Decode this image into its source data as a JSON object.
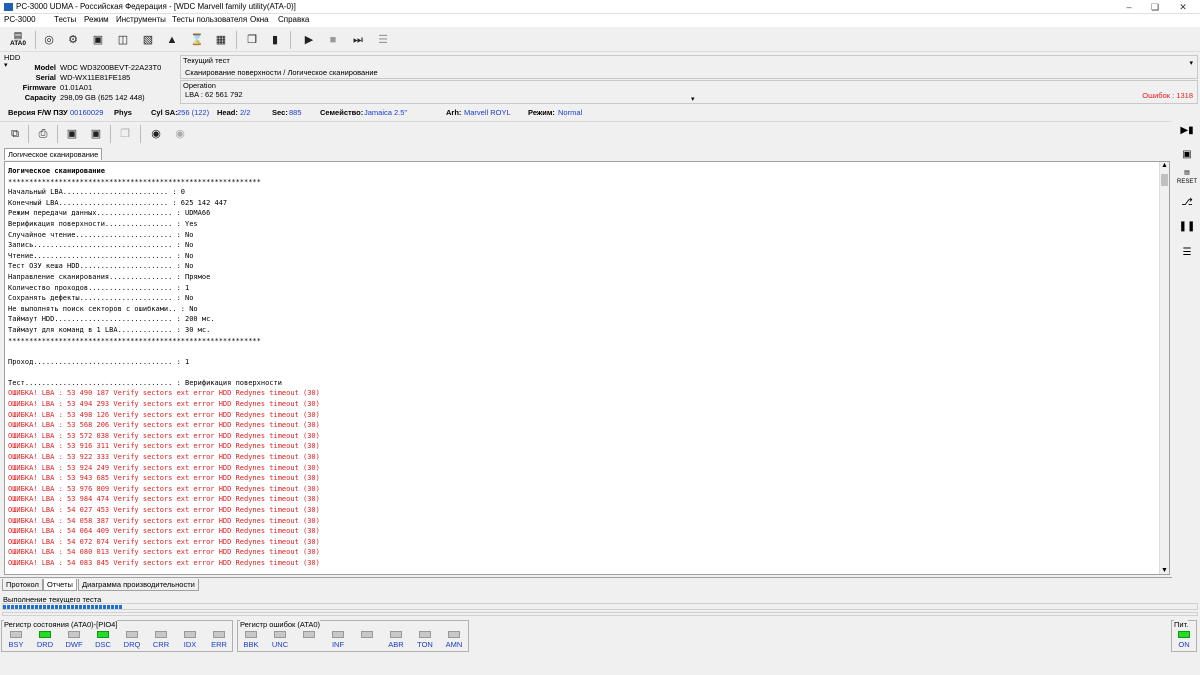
{
  "window": {
    "title": "PC-3000 UDMA - Российская Федерация - [WDC Marvell family utility(ATA-0)]"
  },
  "menu": [
    "PC-3000",
    "Тесты",
    "Режим",
    "Инструменты",
    "Тесты пользователя",
    "Окна",
    "Справка"
  ],
  "toolbar": {
    "ata_label": "ATA0"
  },
  "hdd": {
    "header": "HDD",
    "model_label": "Model",
    "model": "WDC WD3200BEVT-22A23T0",
    "serial_label": "Serial",
    "serial": "WD-WX11E81FE185",
    "firmware_label": "Firmware",
    "firmware": "01.01A01",
    "capacity_label": "Capacity",
    "capacity": "298,09 GB (625 142 448)"
  },
  "current_test": {
    "header": "Текущий тест",
    "value": "Сканирование поверхности / Логическое сканирование"
  },
  "operation": {
    "header": "Operation",
    "value": "LBA : 62 561 792",
    "errors": "Ошибок : 1318"
  },
  "info": {
    "fw_label": "Версия F/W ПЗУ",
    "fw": "00160029",
    "phys_label": "Phys",
    "cyl_label": "Cyl SA:",
    "cyl": "256 (122)",
    "head_label": "Head:",
    "head": "2/2",
    "sec_label": "Sec:",
    "sec": "885",
    "family_label": "Семейство:",
    "family": "Jamaica 2.5\"",
    "arh_label": "Arh:",
    "arh": "Marvell ROYL",
    "mode_label": "Режим:",
    "mode": "Normal"
  },
  "doc_tab": "Логическое сканирование",
  "log": {
    "lines": [
      "Логическое сканирование",
      "************************************************************",
      "Начальный LBA......................... : 0",
      "Конечный LBA.......................... : 625 142 447",
      "Режим передачи данных.................. : UDMA66",
      "Верификация поверхности................ : Yes",
      "Случайное чтение....................... : No",
      "Запись................................. : No",
      "Чтение................................. : No",
      "Тест ОЗУ кеша HDD...................... : No",
      "Направление сканирования............... : Прямое",
      "Количество проходов.................... : 1",
      "Сохранять дефекты...................... : No",
      "Не выполнять поиск секторов с ошибками.. : No",
      "Таймаут HDD............................ : 200 мс.",
      "Таймаут для команд в 1 LBA............. : 30 мс.",
      "************************************************************",
      "",
      "Проход................................. : 1",
      "",
      "Тест................................... : Верификация поверхности"
    ],
    "errors": [
      "ОШИБКА! LBA : 53 490 187 Verify sectors ext error HDD Redynes timeout (30)",
      "ОШИБКА! LBA : 53 494 293 Verify sectors ext error HDD Redynes timeout (30)",
      "ОШИБКА! LBA : 53 498 126 Verify sectors ext error HDD Redynes timeout (30)",
      "ОШИБКА! LBA : 53 568 206 Verify sectors ext error HDD Redynes timeout (30)",
      "ОШИБКА! LBA : 53 572 038 Verify sectors ext error HDD Redynes timeout (30)",
      "ОШИБКА! LBA : 53 916 311 Verify sectors ext error HDD Redynes timeout (30)",
      "ОШИБКА! LBA : 53 922 333 Verify sectors ext error HDD Redynes timeout (30)",
      "ОШИБКА! LBA : 53 924 249 Verify sectors ext error HDD Redynes timeout (30)",
      "ОШИБКА! LBA : 53 943 685 Verify sectors ext error HDD Redynes timeout (30)",
      "ОШИБКА! LBA : 53 976 809 Verify sectors ext error HDD Redynes timeout (30)",
      "ОШИБКА! LBA : 53 984 474 Verify sectors ext error HDD Redynes timeout (30)",
      "ОШИБКА! LBA : 54 027 453 Verify sectors ext error HDD Redynes timeout (30)",
      "ОШИБКА! LBA : 54 058 387 Verify sectors ext error HDD Redynes timeout (30)",
      "ОШИБКА! LBA : 54 064 409 Verify sectors ext error HDD Redynes timeout (30)",
      "ОШИБКА! LBA : 54 072 074 Verify sectors ext error HDD Redynes timeout (30)",
      "ОШИБКА! LBA : 54 080 013 Verify sectors ext error HDD Redynes timeout (30)",
      "ОШИБКА! LBA : 54 083 845 Verify sectors ext error HDD Redynes timeout (30)"
    ]
  },
  "bottom_tabs": [
    "Протокол",
    "Отчеты",
    "Диаграмма производительности"
  ],
  "progress": {
    "label": "Выполнение текущего теста",
    "fraction": 0.1
  },
  "status_register": {
    "label": "Регистр состояния (ATA0)-[PIO4]",
    "leds": [
      {
        "name": "BSY",
        "on": false
      },
      {
        "name": "DRD",
        "on": true
      },
      {
        "name": "DWF",
        "on": false
      },
      {
        "name": "DSC",
        "on": true
      },
      {
        "name": "DRQ",
        "on": false
      },
      {
        "name": "CRR",
        "on": false
      },
      {
        "name": "IDX",
        "on": false
      },
      {
        "name": "ERR",
        "on": false
      }
    ]
  },
  "error_register": {
    "label": "Регистр ошибок  (ATA0)",
    "leds": [
      {
        "name": "BBK",
        "on": false
      },
      {
        "name": "UNC",
        "on": false
      },
      {
        "name": "",
        "on": false
      },
      {
        "name": "INF",
        "on": false
      },
      {
        "name": "",
        "on": false
      },
      {
        "name": "ABR",
        "on": false
      },
      {
        "name": "TON",
        "on": false
      },
      {
        "name": "AMN",
        "on": false
      }
    ]
  },
  "power": {
    "label": "Пит.",
    "on_label": "ON"
  },
  "colors": {
    "error": "#e02020",
    "value_blue": "#1a3cc8",
    "led_on": "#22dd22"
  }
}
